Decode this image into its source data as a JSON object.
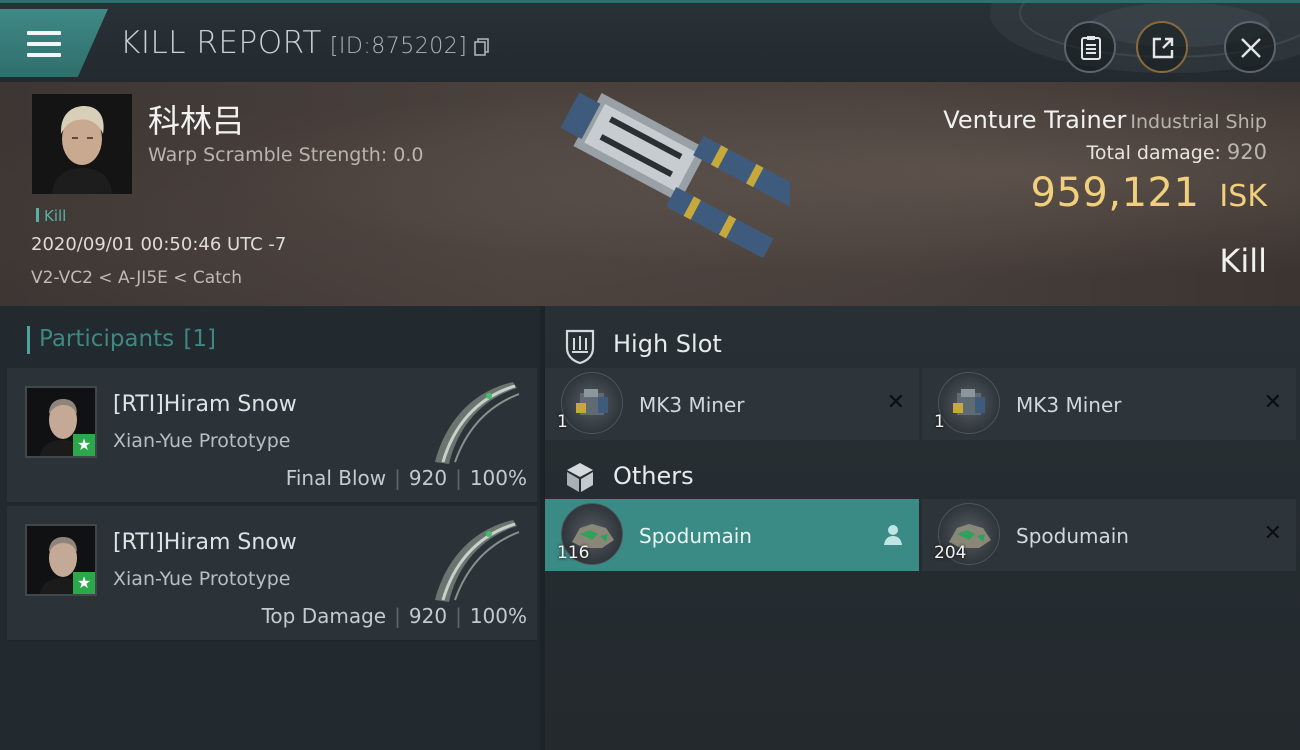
{
  "header": {
    "title": "KILL REPORT",
    "report_id": "[ID:875202]"
  },
  "victim": {
    "name": "科林吕",
    "warp_scramble": "Warp Scramble Strength: 0.0",
    "kill_tag": "Kill",
    "datetime": "2020/09/01 00:50:46 UTC -7",
    "location": "V2-VC2 < A-JI5E < Catch",
    "ship_name": "Venture Trainer",
    "ship_class": "Industrial Ship",
    "total_damage_label": "Total damage:",
    "total_damage": "920",
    "isk_value": "959,121",
    "isk_unit": "ISK",
    "result": "Kill"
  },
  "participants": {
    "label": "Participants",
    "count": "[1]",
    "rows": [
      {
        "name": "[RTI]Hiram Snow",
        "ship": "Xian-Yue Prototype",
        "role": "Final Blow",
        "damage": "920",
        "percent": "100%"
      },
      {
        "name": "[RTI]Hiram Snow",
        "ship": "Xian-Yue Prototype",
        "role": "Top Damage",
        "damage": "920",
        "percent": "100%"
      }
    ]
  },
  "sections": {
    "high_slot": {
      "label": "High Slot",
      "items": [
        {
          "name": "MK3 Miner",
          "qty": "1"
        },
        {
          "name": "MK3 Miner",
          "qty": "1"
        }
      ]
    },
    "others": {
      "label": "Others",
      "items": [
        {
          "name": "Spodumain",
          "qty": "116"
        },
        {
          "name": "Spodumain",
          "qty": "204"
        }
      ]
    }
  },
  "colors": {
    "accent": "#3a8a85",
    "isk": "#f1cf7c",
    "panel": "#2d353a"
  },
  "icons": [
    "menu-icon",
    "copy-icon",
    "clipboard-icon",
    "share-icon",
    "close-icon",
    "high-slot-icon",
    "cube-icon",
    "user-icon",
    "remove-icon",
    "star-icon"
  ]
}
